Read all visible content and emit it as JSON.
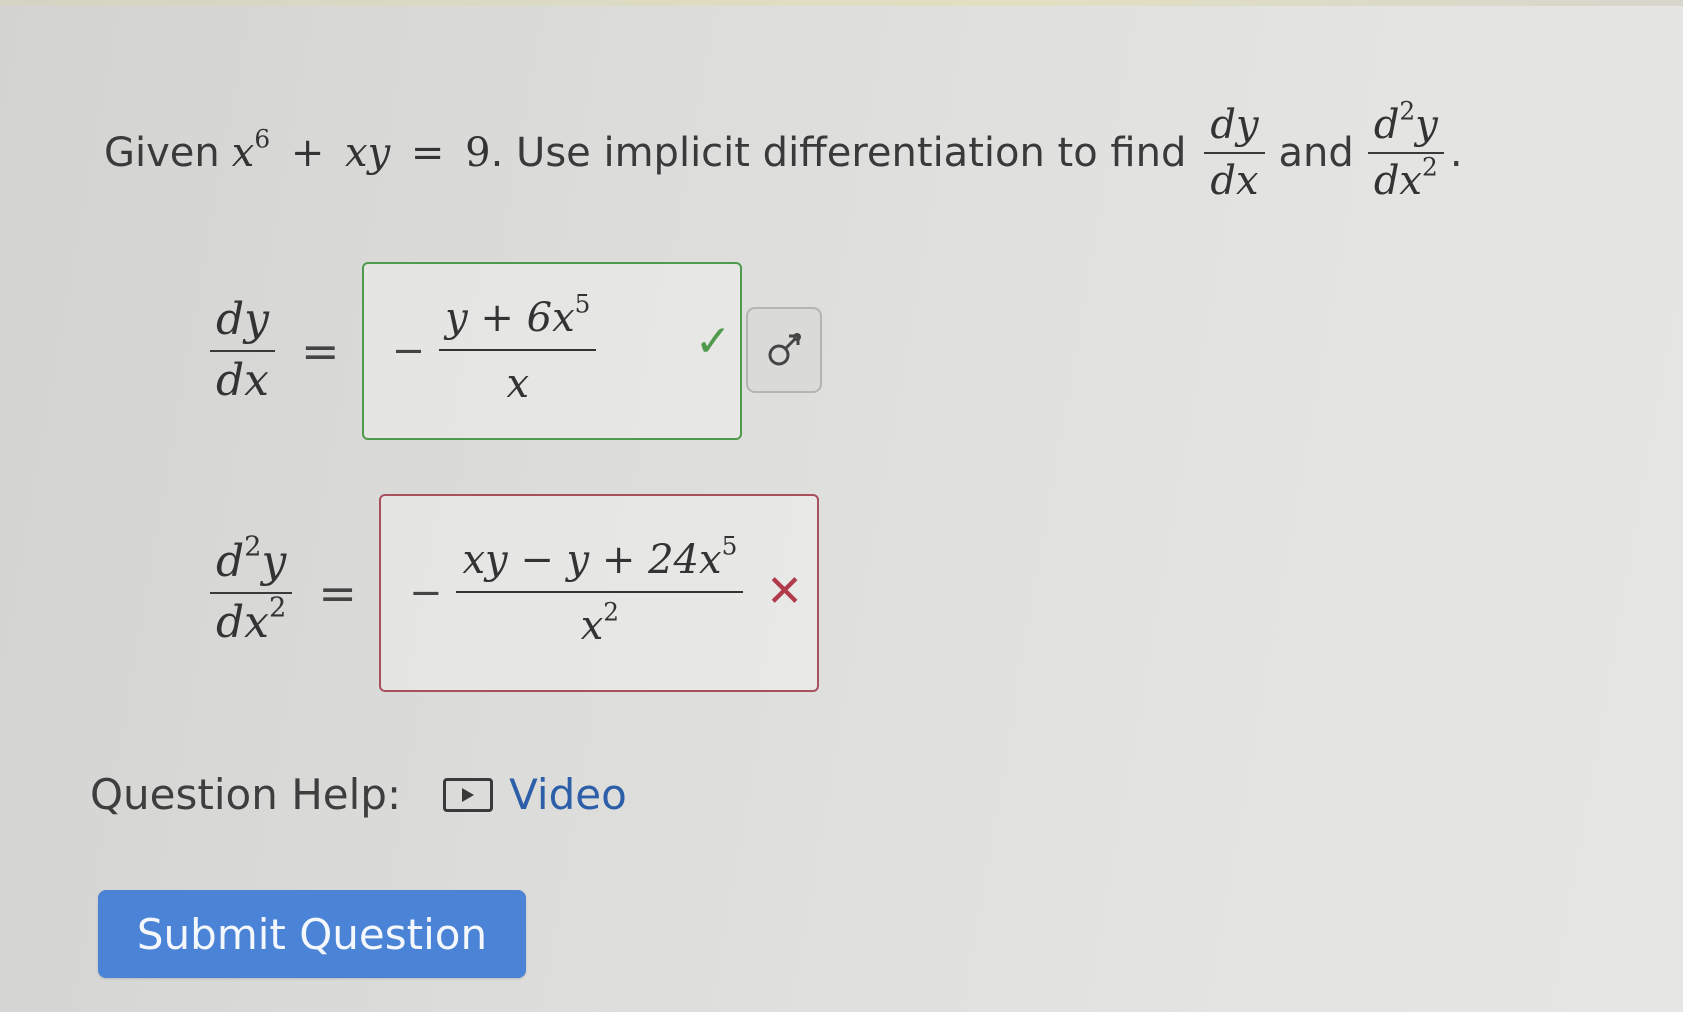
{
  "question": {
    "given_label": "Given",
    "equation": {
      "term1_base": "x",
      "term1_exp": "6",
      "plus": "+",
      "term2": "xy",
      "equals": "=",
      "rhs": "9"
    },
    "sentence": ". Use implicit differentiation to find",
    "first_derivative": {
      "num": "dy",
      "den": "dx"
    },
    "and_label": "and",
    "second_derivative": {
      "num_d": "d",
      "num_exp": "2",
      "num_var": "y",
      "den_var": "dx",
      "den_exp": "2"
    },
    "period": "."
  },
  "answer1": {
    "lhs": {
      "num": "dy",
      "den": "dx"
    },
    "equals": "=",
    "value": {
      "sign": "−",
      "num_base": "y + 6x",
      "num_exp": "5",
      "den": "x"
    },
    "status": "correct",
    "status_color": "#4f9a4c"
  },
  "answer2": {
    "lhs": {
      "num_d": "d",
      "num_exp": "2",
      "num_var": "y",
      "den_var": "dx",
      "den_exp": "2"
    },
    "equals": "=",
    "value": {
      "sign": "−",
      "num_base": "xy − y + 24x",
      "num_exp": "5",
      "den_base": "x",
      "den_exp": "2"
    },
    "status": "incorrect",
    "status_color": "#b03b4c"
  },
  "icons": {
    "correct": "check-icon",
    "incorrect": "cross-icon",
    "preview": "gender-symbol-icon",
    "video": "play-icon"
  },
  "help": {
    "label": "Question Help:",
    "video_label": "Video"
  },
  "submit": {
    "label": "Submit Question",
    "color": "#4b84d6"
  }
}
